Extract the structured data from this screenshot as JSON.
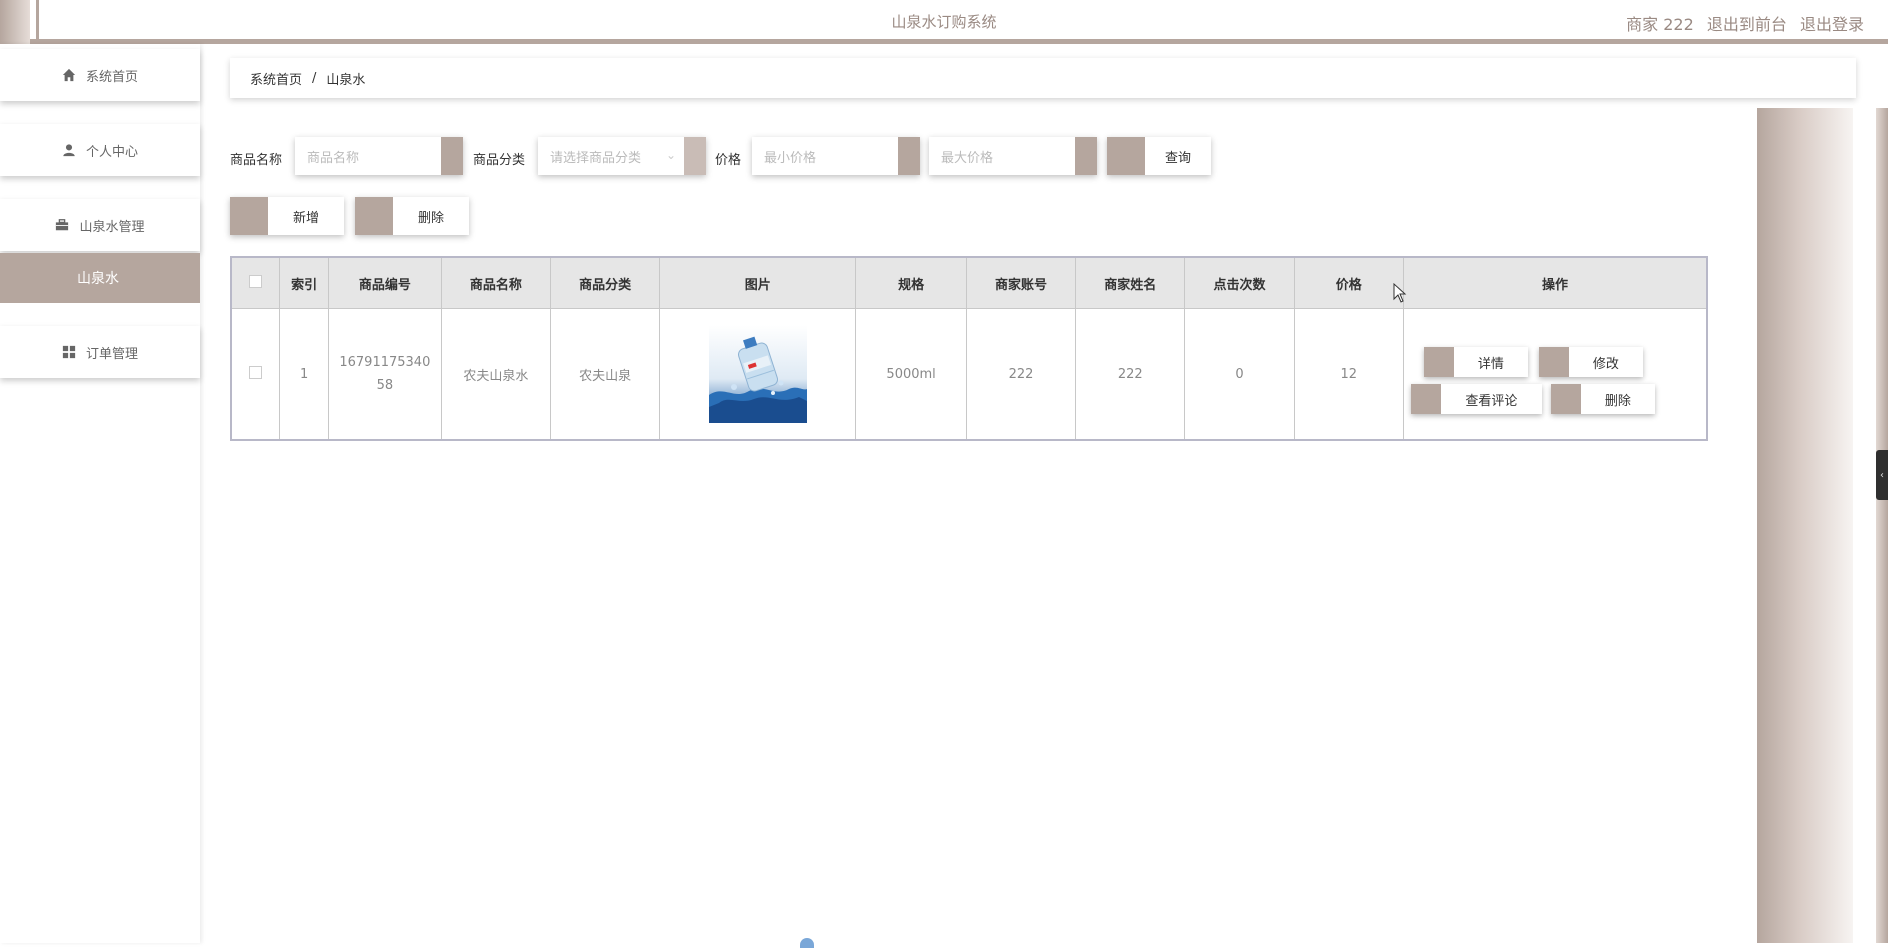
{
  "header": {
    "title": "山泉水订购系统",
    "user": "商家 222",
    "exit_front": "退出到前台",
    "logout": "退出登录"
  },
  "sidebar": {
    "items": [
      {
        "label": "系统首页",
        "icon": "home-icon"
      },
      {
        "label": "个人中心",
        "icon": "user-icon"
      },
      {
        "label": "山泉水管理",
        "icon": "briefcase-icon"
      },
      {
        "label": "订单管理",
        "icon": "grid-icon"
      }
    ],
    "active_sub": "山泉水"
  },
  "breadcrumb": {
    "home": "系统首页",
    "sep": "/",
    "current": "山泉水"
  },
  "search": {
    "name_label": "商品名称",
    "name_placeholder": "商品名称",
    "category_label": "商品分类",
    "category_placeholder": "请选择商品分类",
    "price_label": "价格",
    "min_placeholder": "最小价格",
    "max_placeholder": "最大价格",
    "query_label": "查询"
  },
  "actions": {
    "add_label": "新增",
    "delete_label": "删除"
  },
  "table": {
    "headers": [
      "索引",
      "商品编号",
      "商品名称",
      "商品分类",
      "图片",
      "规格",
      "商家账号",
      "商家姓名",
      "点击次数",
      "价格",
      "操作"
    ],
    "rows": [
      {
        "index": "1",
        "code_line1": "16791175340",
        "code_line2": "58",
        "name": "农夫山泉水",
        "category": "农夫山泉",
        "spec": "5000ml",
        "merchant_account": "222",
        "merchant_name": "222",
        "clicks": "0",
        "price": "12",
        "ops": {
          "detail": "详情",
          "edit": "修改",
          "comments": "查看评论",
          "delete": "删除"
        }
      }
    ]
  },
  "colors": {
    "accent": "#b5a69e",
    "header_bg": "#e6e6e6"
  }
}
